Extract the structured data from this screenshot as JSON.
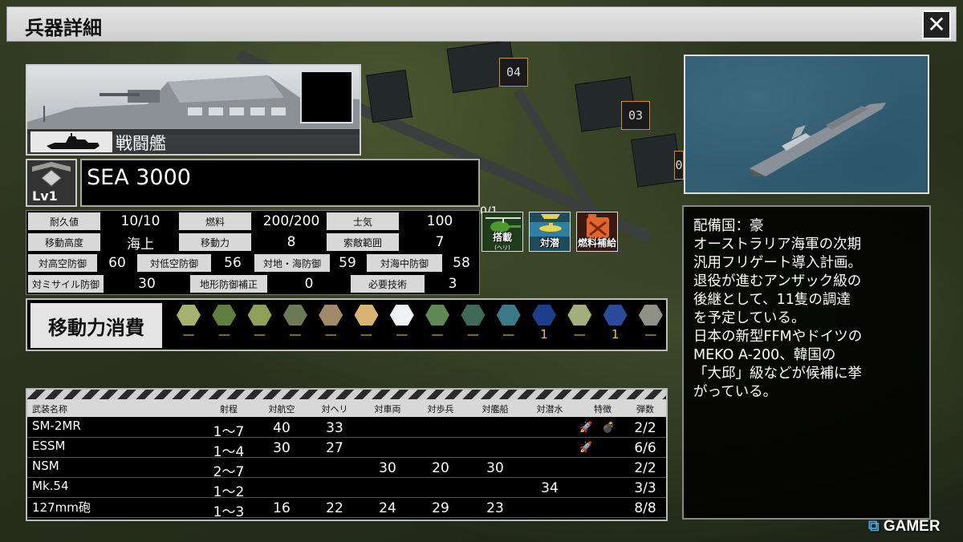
{
  "window": {
    "title": "兵器詳細"
  },
  "map": {
    "tiles": [
      "04",
      "03",
      "0"
    ]
  },
  "unit": {
    "type": "戦闘艦",
    "level": "Lv1",
    "name": "SEA 3000"
  },
  "stats": {
    "durability": {
      "label": "耐久値",
      "value": "10/10"
    },
    "fuel": {
      "label": "燃料",
      "value": "200/200"
    },
    "morale": {
      "label": "士気",
      "value": "100"
    },
    "altitude": {
      "label": "移動高度",
      "value": "海上"
    },
    "move": {
      "label": "移動力",
      "value": "8"
    },
    "search": {
      "label": "索敵範囲",
      "value": "7"
    },
    "def_high_air": {
      "label": "対高空防御",
      "value": "60"
    },
    "def_low_air": {
      "label": "対低空防御",
      "value": "56"
    },
    "def_ground_sea": {
      "label": "対地・海防御",
      "value": "59"
    },
    "def_undersea": {
      "label": "対海中防御",
      "value": "58"
    },
    "def_missile": {
      "label": "対ミサイル防御",
      "value": "30"
    },
    "terrain_bonus": {
      "label": "地形防御補正",
      "value": "0"
    },
    "tech": {
      "label": "必要技術",
      "value": "3"
    }
  },
  "abilities": {
    "count": "0/1",
    "items": [
      {
        "label": "搭載",
        "sub": "(ヘリ)",
        "icon": "helicopter-icon"
      },
      {
        "label": "対潜",
        "icon": "anti-submarine-icon"
      },
      {
        "label": "燃料補給",
        "icon": "fuel-can-icon"
      }
    ]
  },
  "movement": {
    "label": "移動力消費",
    "terrains": [
      {
        "color": "#a6b26e",
        "cost": "—"
      },
      {
        "color": "#5f7f3f",
        "cost": "—"
      },
      {
        "color": "#8fa05a",
        "cost": "—"
      },
      {
        "color": "#6c7a55",
        "cost": "—"
      },
      {
        "color": "#a08a68",
        "cost": "—"
      },
      {
        "color": "#d9b473",
        "cost": "—"
      },
      {
        "color": "#eef2f2",
        "cost": "—"
      },
      {
        "color": "#5f8a54",
        "cost": "—"
      },
      {
        "color": "#3f6a5a",
        "cost": "—"
      },
      {
        "color": "#3c7a8a",
        "cost": "—"
      },
      {
        "color": "#1e3e8a",
        "cost": "1"
      },
      {
        "color": "#a4ad7c",
        "cost": "—"
      },
      {
        "color": "#2a4a9a",
        "cost": "1"
      },
      {
        "color": "#8e9184",
        "cost": "—"
      }
    ]
  },
  "weapons": {
    "headers": [
      "武装名称",
      "射程",
      "対航空",
      "対ヘリ",
      "対車両",
      "対歩兵",
      "対艦船",
      "対潜水",
      "特徴",
      "弾数"
    ],
    "rows": [
      {
        "name": "SM-2MR",
        "range": "1〜7",
        "air": "40",
        "heli": "33",
        "vehicle": "",
        "infantry": "",
        "ship": "",
        "sub": "",
        "traits": [
          "missile-icon",
          "bomb-icon"
        ],
        "ammo": "2/2"
      },
      {
        "name": "ESSM",
        "range": "1〜4",
        "air": "30",
        "heli": "27",
        "vehicle": "",
        "infantry": "",
        "ship": "",
        "sub": "",
        "traits": [
          "missile-icon"
        ],
        "ammo": "6/6"
      },
      {
        "name": "NSM",
        "range": "2〜7",
        "air": "",
        "heli": "",
        "vehicle": "30",
        "infantry": "20",
        "ship": "30",
        "sub": "",
        "traits": [],
        "ammo": "2/2"
      },
      {
        "name": "Mk.54",
        "range": "1〜2",
        "air": "",
        "heli": "",
        "vehicle": "",
        "infantry": "",
        "ship": "",
        "sub": "34",
        "traits": [],
        "ammo": "3/3"
      },
      {
        "name": "127mm砲",
        "range": "1〜3",
        "air": "16",
        "heli": "22",
        "vehicle": "24",
        "infantry": "29",
        "ship": "23",
        "sub": "",
        "traits": [],
        "ammo": "8/8"
      }
    ]
  },
  "description": {
    "lines": [
      "配備国：豪",
      "オーストラリア海軍の次期",
      "汎用フリゲート導入計画。",
      "退役が進むアンザック級の",
      "後継として、11隻の調達",
      "を予定している。",
      "日本の新型FFMやドイツの",
      "MEKO A-200、韓国の",
      "「大邱」級などが候補に挙",
      "がっている。"
    ]
  },
  "watermark": {
    "mark": "⧉",
    "text": "GAMER"
  }
}
